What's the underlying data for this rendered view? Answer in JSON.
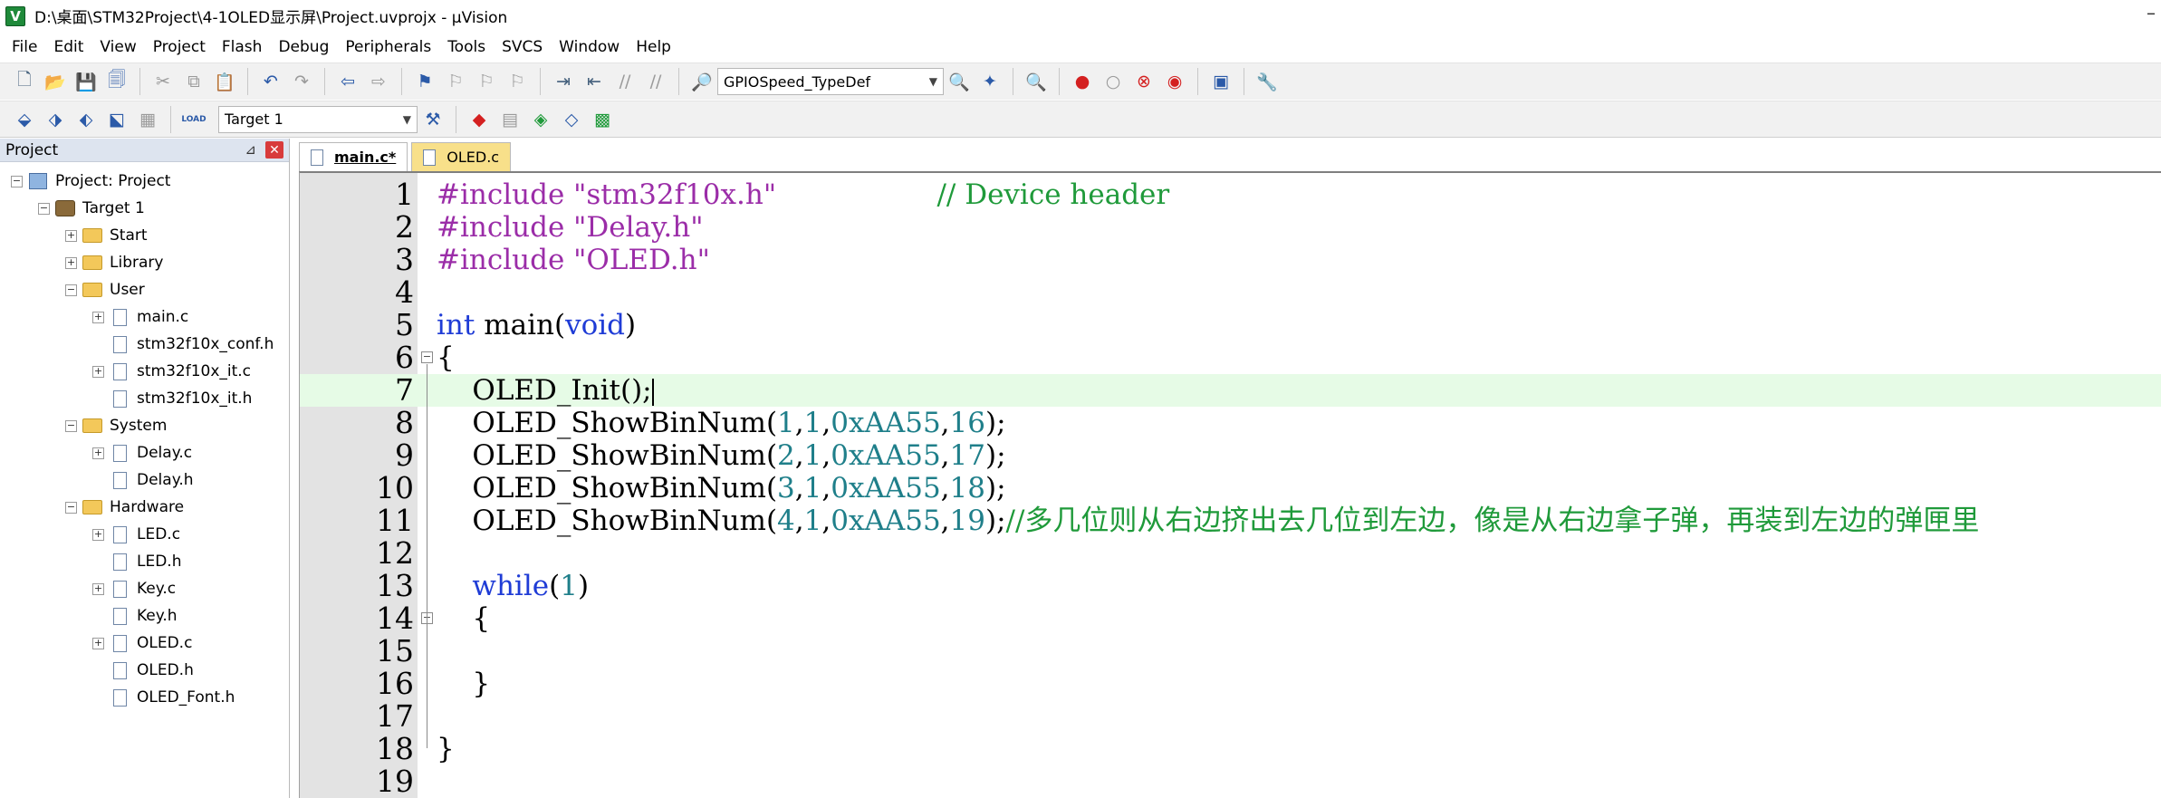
{
  "window": {
    "title": "D:\\桌面\\STM32Project\\4-1OLED显示屏\\Project.uvprojx - µVision",
    "app_icon": "V",
    "minimize": "–"
  },
  "menu": [
    "File",
    "Edit",
    "View",
    "Project",
    "Flash",
    "Debug",
    "Peripherals",
    "Tools",
    "SVCS",
    "Window",
    "Help"
  ],
  "toolbar": {
    "find_combo": "GPIOSpeed_TypeDef",
    "target_combo": "Target 1",
    "load_label": "LOAD"
  },
  "project_panel": {
    "title": "Project",
    "pin": "⊿",
    "close": "✕",
    "tree": [
      {
        "label": "Project: Project",
        "level": 0,
        "expander": "−",
        "icon": "project"
      },
      {
        "label": "Target 1",
        "level": 1,
        "expander": "−",
        "icon": "target"
      },
      {
        "label": "Start",
        "level": 2,
        "expander": "+",
        "icon": "folder"
      },
      {
        "label": "Library",
        "level": 2,
        "expander": "+",
        "icon": "folder"
      },
      {
        "label": "User",
        "level": 2,
        "expander": "−",
        "icon": "folder"
      },
      {
        "label": "main.c",
        "level": 3,
        "expander": "+",
        "icon": "file"
      },
      {
        "label": "stm32f10x_conf.h",
        "level": 3,
        "expander": "",
        "icon": "file"
      },
      {
        "label": "stm32f10x_it.c",
        "level": 3,
        "expander": "+",
        "icon": "file"
      },
      {
        "label": "stm32f10x_it.h",
        "level": 3,
        "expander": "",
        "icon": "file"
      },
      {
        "label": "System",
        "level": 2,
        "expander": "−",
        "icon": "folder"
      },
      {
        "label": "Delay.c",
        "level": 3,
        "expander": "+",
        "icon": "file"
      },
      {
        "label": "Delay.h",
        "level": 3,
        "expander": "",
        "icon": "file"
      },
      {
        "label": "Hardware",
        "level": 2,
        "expander": "−",
        "icon": "folder"
      },
      {
        "label": "LED.c",
        "level": 3,
        "expander": "+",
        "icon": "file"
      },
      {
        "label": "LED.h",
        "level": 3,
        "expander": "",
        "icon": "file"
      },
      {
        "label": "Key.c",
        "level": 3,
        "expander": "+",
        "icon": "file"
      },
      {
        "label": "Key.h",
        "level": 3,
        "expander": "",
        "icon": "file"
      },
      {
        "label": "OLED.c",
        "level": 3,
        "expander": "+",
        "icon": "file"
      },
      {
        "label": "OLED.h",
        "level": 3,
        "expander": "",
        "icon": "file"
      },
      {
        "label": "OLED_Font.h",
        "level": 3,
        "expander": "",
        "icon": "file"
      }
    ]
  },
  "tabs": [
    {
      "label": "main.c*",
      "active": true
    },
    {
      "label": "OLED.c",
      "active": false
    }
  ],
  "code_lines": [
    {
      "n": "1",
      "html": "<span class='str'>#include \"stm32f10x.h\"</span>                  <span class='cmt'>// Device header</span>"
    },
    {
      "n": "2",
      "html": "<span class='str'>#include \"Delay.h\"</span>"
    },
    {
      "n": "3",
      "html": "<span class='str'>#include \"OLED.h\"</span>"
    },
    {
      "n": "4",
      "html": ""
    },
    {
      "n": "5",
      "html": "<span class='kw'>int</span> main(<span class='kw'>void</span>)"
    },
    {
      "n": "6",
      "html": "{",
      "fold": "−"
    },
    {
      "n": "7",
      "html": "    OLED_Init();<span class='caret'></span>",
      "current": true
    },
    {
      "n": "8",
      "html": "    OLED_ShowBinNum(<span class='num'>1</span>,<span class='num'>1</span>,<span class='num'>0xAA55</span>,<span class='num'>16</span>);"
    },
    {
      "n": "9",
      "html": "    OLED_ShowBinNum(<span class='num'>2</span>,<span class='num'>1</span>,<span class='num'>0xAA55</span>,<span class='num'>17</span>);"
    },
    {
      "n": "10",
      "html": "    OLED_ShowBinNum(<span class='num'>3</span>,<span class='num'>1</span>,<span class='num'>0xAA55</span>,<span class='num'>18</span>);"
    },
    {
      "n": "11",
      "html": "    OLED_ShowBinNum(<span class='num'>4</span>,<span class='num'>1</span>,<span class='num'>0xAA55</span>,<span class='num'>19</span>);<span class='cmt'>//多几位则从右边挤出去几位到左边，像是从右边拿子弹，再装到左边的弹匣里</span>"
    },
    {
      "n": "12",
      "html": ""
    },
    {
      "n": "13",
      "html": "    <span class='kw'>while</span>(<span class='num'>1</span>)"
    },
    {
      "n": "14",
      "html": "    {",
      "fold": "−"
    },
    {
      "n": "15",
      "html": ""
    },
    {
      "n": "16",
      "html": "    }"
    },
    {
      "n": "17",
      "html": ""
    },
    {
      "n": "18",
      "html": "}"
    },
    {
      "n": "19",
      "html": ""
    }
  ],
  "colors": {
    "keyword": "#1f3cd6",
    "string": "#9b2da8",
    "number": "#1f7f8a",
    "comment": "#1f9a3a",
    "current_line": "#e6fbe6",
    "inactive_tab": "#f8e08a"
  }
}
